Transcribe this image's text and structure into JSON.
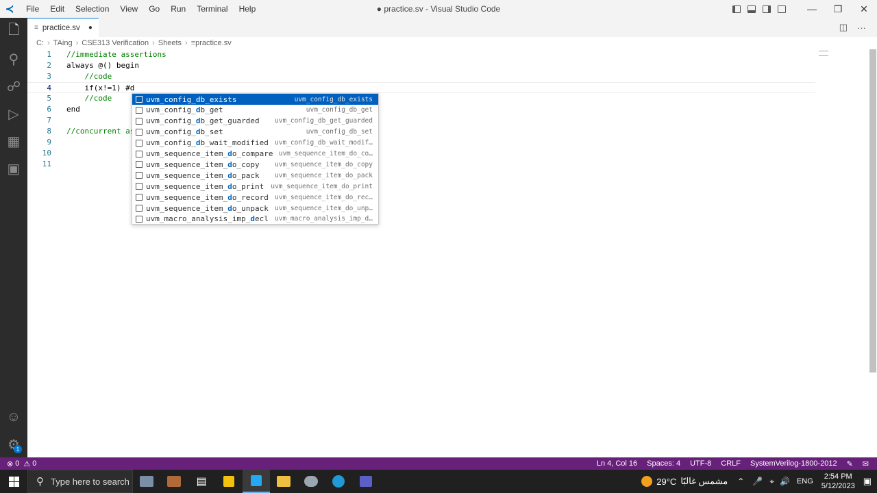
{
  "titlebar": {
    "menu": [
      "File",
      "Edit",
      "Selection",
      "View",
      "Go",
      "Run",
      "Terminal",
      "Help"
    ],
    "title": "● practice.sv - Visual Studio Code"
  },
  "tab": {
    "name": "practice.sv",
    "modified": "●"
  },
  "breadcrumb": [
    "C:",
    "TAing",
    "CSE313 Verification",
    "Sheets",
    "practice.sv"
  ],
  "editor": {
    "lines": [
      {
        "num": "1",
        "text": "//immediate assertions",
        "comment": true
      },
      {
        "num": "2",
        "text": "always @() begin",
        "comment": false
      },
      {
        "num": "3",
        "text": "    //code",
        "comment": true
      },
      {
        "num": "4",
        "text": "    if(x!=1) #d",
        "comment": false
      },
      {
        "num": "5",
        "text": "    //code",
        "comment": true
      },
      {
        "num": "6",
        "text": "end",
        "comment": false
      },
      {
        "num": "7",
        "text": "",
        "comment": false
      },
      {
        "num": "8",
        "text": "//concurrent as",
        "comment": true
      },
      {
        "num": "9",
        "text": "",
        "comment": false
      },
      {
        "num": "10",
        "text": "",
        "comment": false
      },
      {
        "num": "11",
        "text": "",
        "comment": false
      }
    ],
    "current_line": 4
  },
  "suggestions": [
    {
      "pre": "uvm_config_",
      "hl": "d",
      "mid": "b_exists",
      "hl2": "",
      "post": "",
      "detail": "uvm_config_db_exists"
    },
    {
      "pre": "uvm_config_",
      "hl": "d",
      "mid": "b_get",
      "hl2": "",
      "post": "",
      "detail": "uvm_config_db_get"
    },
    {
      "pre": "uvm_config_",
      "hl": "d",
      "mid": "b_get_guarded",
      "hl2": "",
      "post": "",
      "detail": "uvm_config_db_get_guarded"
    },
    {
      "pre": "uvm_config_",
      "hl": "d",
      "mid": "b_set",
      "hl2": "",
      "post": "",
      "detail": "uvm_config_db_set"
    },
    {
      "pre": "uvm_config_",
      "hl": "d",
      "mid": "b_wait_modified",
      "hl2": "",
      "post": "",
      "detail": "uvm_config_db_wait_modif…"
    },
    {
      "pre": "uvm_sequence_item_",
      "hl": "d",
      "mid": "o_compare",
      "hl2": "",
      "post": "",
      "detail": "uvm_sequence_item_do_co…"
    },
    {
      "pre": "uvm_sequence_item_",
      "hl": "d",
      "mid": "o_copy",
      "hl2": "",
      "post": "",
      "detail": "uvm_sequence_item_do_copy"
    },
    {
      "pre": "uvm_sequence_item_",
      "hl": "d",
      "mid": "o_pack",
      "hl2": "",
      "post": "",
      "detail": "uvm_sequence_item_do_pack"
    },
    {
      "pre": "uvm_sequence_item_",
      "hl": "d",
      "mid": "o_print",
      "hl2": "",
      "post": "",
      "detail": "uvm_sequence_item_do_print"
    },
    {
      "pre": "uvm_sequence_item_",
      "hl": "d",
      "mid": "o_record",
      "hl2": "",
      "post": "",
      "detail": "uvm_sequence_item_do_rec…"
    },
    {
      "pre": "uvm_sequence_item_",
      "hl": "d",
      "mid": "o_unpack",
      "hl2": "",
      "post": "",
      "detail": "uvm_sequence_item_do_unp…"
    },
    {
      "pre": "uvm_macro_analysis_imp_",
      "hl": "d",
      "mid": "ecl",
      "hl2": "",
      "post": "",
      "detail": "uvm_macro_analysis_imp_d…"
    }
  ],
  "status": {
    "errors": "0",
    "warnings": "0",
    "position": "Ln 4, Col 16",
    "spaces": "Spaces: 4",
    "encoding": "UTF-8",
    "eol": "CRLF",
    "language": "SystemVerilog-1800-2012"
  },
  "taskbar": {
    "search_placeholder": "Type here to search",
    "temperature": "29°C",
    "weather_text": "مشمس غالبًا",
    "lang": "ENG",
    "time": "2:54 PM",
    "date": "5/12/2023"
  },
  "colors": {
    "accent": "#0078d4",
    "statusbar": "#68217a",
    "suggest_selected": "#0060c0",
    "comment": "#008000",
    "line_number": "#237893"
  }
}
